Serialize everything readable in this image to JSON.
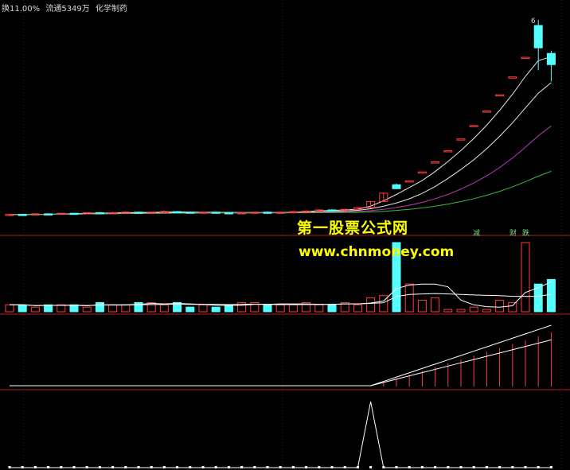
{
  "header": {
    "turnover": "换11.00%",
    "float": "流通5349万",
    "sector": "化学制药"
  },
  "price_label": "6",
  "watermark": {
    "line1": "第一股票公式网",
    "line2": "www.chnmoney.com"
  },
  "tags": [
    "减",
    "财",
    "跌"
  ],
  "colors": {
    "up": "#ff3b3b",
    "down": "#54ffff",
    "ma1": "#ffffff",
    "ma2": "#ffffff",
    "ma3": "#d040d0",
    "ma4": "#40d040",
    "watermark": "#ffff00"
  },
  "chart_data": {
    "type": "candlestick",
    "note_units": "relative price index",
    "candles": [
      {
        "o": 1.0,
        "c": 1.02,
        "h": 1.03,
        "l": 0.99
      },
      {
        "o": 1.02,
        "c": 1.01,
        "h": 1.03,
        "l": 1.0
      },
      {
        "o": 1.01,
        "c": 1.03,
        "h": 1.04,
        "l": 1.0
      },
      {
        "o": 1.03,
        "c": 1.02,
        "h": 1.04,
        "l": 1.01
      },
      {
        "o": 1.02,
        "c": 1.04,
        "h": 1.05,
        "l": 1.01
      },
      {
        "o": 1.04,
        "c": 1.03,
        "h": 1.05,
        "l": 1.02
      },
      {
        "o": 1.03,
        "c": 1.05,
        "h": 1.06,
        "l": 1.02
      },
      {
        "o": 1.05,
        "c": 1.04,
        "h": 1.06,
        "l": 1.03
      },
      {
        "o": 1.04,
        "c": 1.05,
        "h": 1.07,
        "l": 1.03
      },
      {
        "o": 1.05,
        "c": 1.06,
        "h": 1.08,
        "l": 1.04
      },
      {
        "o": 1.06,
        "c": 1.05,
        "h": 1.07,
        "l": 1.04
      },
      {
        "o": 1.05,
        "c": 1.06,
        "h": 1.07,
        "l": 1.04
      },
      {
        "o": 1.06,
        "c": 1.07,
        "h": 1.09,
        "l": 1.05
      },
      {
        "o": 1.07,
        "c": 1.06,
        "h": 1.08,
        "l": 1.05
      },
      {
        "o": 1.06,
        "c": 1.05,
        "h": 1.07,
        "l": 1.04
      },
      {
        "o": 1.05,
        "c": 1.06,
        "h": 1.07,
        "l": 1.04
      },
      {
        "o": 1.06,
        "c": 1.05,
        "h": 1.07,
        "l": 1.04
      },
      {
        "o": 1.05,
        "c": 1.04,
        "h": 1.06,
        "l": 1.03
      },
      {
        "o": 1.04,
        "c": 1.05,
        "h": 1.06,
        "l": 1.03
      },
      {
        "o": 1.05,
        "c": 1.06,
        "h": 1.07,
        "l": 1.04
      },
      {
        "o": 1.06,
        "c": 1.05,
        "h": 1.07,
        "l": 1.04
      },
      {
        "o": 1.05,
        "c": 1.06,
        "h": 1.07,
        "l": 1.04
      },
      {
        "o": 1.06,
        "c": 1.07,
        "h": 1.08,
        "l": 1.05
      },
      {
        "o": 1.07,
        "c": 1.08,
        "h": 1.09,
        "l": 1.06
      },
      {
        "o": 1.08,
        "c": 1.1,
        "h": 1.11,
        "l": 1.07
      },
      {
        "o": 1.1,
        "c": 1.09,
        "h": 1.11,
        "l": 1.08
      },
      {
        "o": 1.09,
        "c": 1.11,
        "h": 1.12,
        "l": 1.08
      },
      {
        "o": 1.11,
        "c": 1.14,
        "h": 1.15,
        "l": 1.1
      },
      {
        "o": 1.14,
        "c": 1.25,
        "h": 1.26,
        "l": 1.13
      },
      {
        "o": 1.25,
        "c": 1.4,
        "h": 1.41,
        "l": 1.24
      },
      {
        "o": 1.55,
        "c": 1.48,
        "h": 1.57,
        "l": 1.47
      },
      {
        "o": 1.62,
        "c": 1.62,
        "h": 1.62,
        "l": 1.62
      },
      {
        "o": 1.78,
        "c": 1.78,
        "h": 1.78,
        "l": 1.78
      },
      {
        "o": 1.96,
        "c": 1.96,
        "h": 1.96,
        "l": 1.96
      },
      {
        "o": 2.16,
        "c": 2.16,
        "h": 2.16,
        "l": 2.16
      },
      {
        "o": 2.37,
        "c": 2.37,
        "h": 2.37,
        "l": 2.37
      },
      {
        "o": 2.61,
        "c": 2.61,
        "h": 2.61,
        "l": 2.61
      },
      {
        "o": 2.87,
        "c": 2.87,
        "h": 2.87,
        "l": 2.87
      },
      {
        "o": 3.16,
        "c": 3.16,
        "h": 3.16,
        "l": 3.16
      },
      {
        "o": 3.48,
        "c": 3.48,
        "h": 3.48,
        "l": 3.48
      },
      {
        "o": 3.83,
        "c": 3.83,
        "h": 3.83,
        "l": 3.83
      },
      {
        "o": 4.4,
        "c": 4.0,
        "h": 4.5,
        "l": 3.6
      },
      {
        "o": 3.9,
        "c": 3.7,
        "h": 3.95,
        "l": 3.4
      }
    ],
    "volume": [
      3,
      3,
      2,
      3,
      3,
      3,
      2,
      4,
      3,
      3,
      4,
      4,
      3,
      4,
      2,
      3,
      2,
      3,
      4,
      4,
      3,
      3,
      3,
      4,
      3,
      3,
      4,
      3,
      6,
      7,
      30,
      12,
      5,
      6,
      1,
      1,
      2,
      1,
      5,
      4,
      30,
      12,
      14
    ],
    "indicator_bars": [
      0,
      0,
      0,
      0,
      0,
      0,
      0,
      0,
      0,
      0,
      0,
      0,
      0,
      0,
      0,
      0,
      0,
      0,
      0,
      0,
      0,
      0,
      0,
      0,
      0,
      0,
      0,
      0,
      0,
      1,
      2,
      3,
      4,
      5,
      6,
      7,
      8,
      9,
      10,
      11,
      12,
      13,
      14
    ],
    "signal_spike_index": 28
  }
}
